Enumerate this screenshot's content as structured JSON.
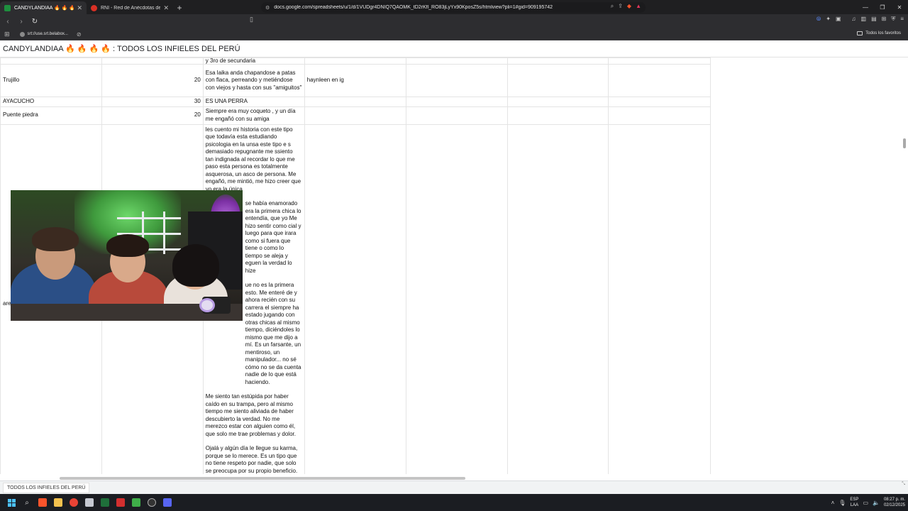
{
  "browser": {
    "tabs": [
      {
        "title": "CANDYLANDIAA 🔥 🔥 🔥 🔥 - G",
        "favicon_color": "#1e8e3e",
        "active": true
      },
      {
        "title": "RNI - Red de Anécdotas de Infidelidad",
        "favicon_color": "#d93025",
        "active": false
      }
    ],
    "new_tab": "+",
    "url": "docs.google.com/spreadsheets/u/1/d/1VUDgr4DNIQ7QAOMK_tD2rKfl_RO83jLyYx90KposZ5s/htmlview?pli=1#gid=909195742",
    "bookmarks": [
      {
        "label": "srt://use.srt.belabox..."
      }
    ],
    "favorites_label": "Todos los favoritos"
  },
  "sheet": {
    "title": "CANDYLANDIAA 🔥 🔥 🔥 🔥 : TODOS LOS INFIELES DEL PERÚ",
    "top_fragment": "y 3ro de secundaria",
    "rows": [
      {
        "city": "Trujillo",
        "age": "20",
        "story": "Esa laika anda chapandose a patas con flaca, perreando y metiéndose con viejos y hasta con sus \"amiguitos\"",
        "contact": "haynleen en ig"
      },
      {
        "city": "AYACUCHO",
        "age": "30",
        "story": "ES UNA PERRA",
        "contact": ""
      },
      {
        "city": "Puente piedra",
        "age": "20",
        "story": "Siempre era muy coqueto , y un día me engañó con su amiga",
        "contact": ""
      },
      {
        "city": "are",
        "age": "",
        "story_paragraphs": [
          "les cuento mi historia con este tipo que todavía esta estudiando psicologia en la unsa este tipo e s demasiado repugnante me ssiento tan indignada al recordar lo que me paso esta persona es totalmente asquerosa, un asco de persona. Me engañó, me mintió, me hizo creer que yo era la única",
          "se había enamorado era la primera chica lo entendía, que yo Me hizo sentir como cial y luego para que irara como si fuera que tiene o como lo tiempo se aleja y eguen la verdad lo hize",
          "ue no es la primera esto. Me enteré de y ahora recién con su carrera el siempre ha estado jugando con otras chicas al mismo tiempo, diciéndoles lo mismo que me dijo a mí. Es un farsante, un mentiroso, un manipulador... no sé cómo no se da cuenta nadie de lo que está haciendo.",
          "Me siento tan estúpida por haber caído en su trampa, pero al mismo tiempo me siento aliviada de haber descubierto la verdad. No me merezco estar con alguien como él, que solo me trae problemas y dolor.",
          "Ojalá y algún día le llegue su karma, porque se lo merece. Es un tipo que no tiene respeto por nadie, que solo se preocupa por su propio beneficio."
        ]
      }
    ],
    "tab_label": "TODOS LOS INFIELES DEL PERÚ"
  },
  "taskbar": {
    "lang_top": "ESP",
    "lang_bottom": "LAA",
    "time": "08:27 p. m.",
    "date": "02/12/2025"
  }
}
